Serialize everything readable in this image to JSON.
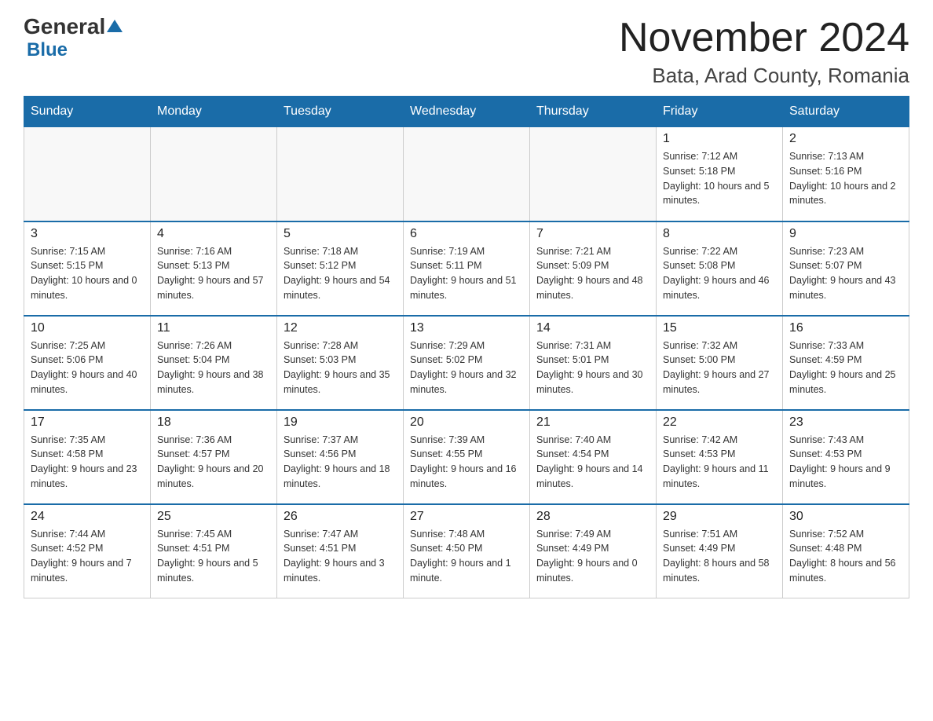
{
  "header": {
    "logo_general": "General",
    "logo_blue": "Blue",
    "month_title": "November 2024",
    "location": "Bata, Arad County, Romania"
  },
  "days_of_week": [
    "Sunday",
    "Monday",
    "Tuesday",
    "Wednesday",
    "Thursday",
    "Friday",
    "Saturday"
  ],
  "weeks": [
    [
      {
        "day": "",
        "info": ""
      },
      {
        "day": "",
        "info": ""
      },
      {
        "day": "",
        "info": ""
      },
      {
        "day": "",
        "info": ""
      },
      {
        "day": "",
        "info": ""
      },
      {
        "day": "1",
        "info": "Sunrise: 7:12 AM\nSunset: 5:18 PM\nDaylight: 10 hours and 5 minutes."
      },
      {
        "day": "2",
        "info": "Sunrise: 7:13 AM\nSunset: 5:16 PM\nDaylight: 10 hours and 2 minutes."
      }
    ],
    [
      {
        "day": "3",
        "info": "Sunrise: 7:15 AM\nSunset: 5:15 PM\nDaylight: 10 hours and 0 minutes."
      },
      {
        "day": "4",
        "info": "Sunrise: 7:16 AM\nSunset: 5:13 PM\nDaylight: 9 hours and 57 minutes."
      },
      {
        "day": "5",
        "info": "Sunrise: 7:18 AM\nSunset: 5:12 PM\nDaylight: 9 hours and 54 minutes."
      },
      {
        "day": "6",
        "info": "Sunrise: 7:19 AM\nSunset: 5:11 PM\nDaylight: 9 hours and 51 minutes."
      },
      {
        "day": "7",
        "info": "Sunrise: 7:21 AM\nSunset: 5:09 PM\nDaylight: 9 hours and 48 minutes."
      },
      {
        "day": "8",
        "info": "Sunrise: 7:22 AM\nSunset: 5:08 PM\nDaylight: 9 hours and 46 minutes."
      },
      {
        "day": "9",
        "info": "Sunrise: 7:23 AM\nSunset: 5:07 PM\nDaylight: 9 hours and 43 minutes."
      }
    ],
    [
      {
        "day": "10",
        "info": "Sunrise: 7:25 AM\nSunset: 5:06 PM\nDaylight: 9 hours and 40 minutes."
      },
      {
        "day": "11",
        "info": "Sunrise: 7:26 AM\nSunset: 5:04 PM\nDaylight: 9 hours and 38 minutes."
      },
      {
        "day": "12",
        "info": "Sunrise: 7:28 AM\nSunset: 5:03 PM\nDaylight: 9 hours and 35 minutes."
      },
      {
        "day": "13",
        "info": "Sunrise: 7:29 AM\nSunset: 5:02 PM\nDaylight: 9 hours and 32 minutes."
      },
      {
        "day": "14",
        "info": "Sunrise: 7:31 AM\nSunset: 5:01 PM\nDaylight: 9 hours and 30 minutes."
      },
      {
        "day": "15",
        "info": "Sunrise: 7:32 AM\nSunset: 5:00 PM\nDaylight: 9 hours and 27 minutes."
      },
      {
        "day": "16",
        "info": "Sunrise: 7:33 AM\nSunset: 4:59 PM\nDaylight: 9 hours and 25 minutes."
      }
    ],
    [
      {
        "day": "17",
        "info": "Sunrise: 7:35 AM\nSunset: 4:58 PM\nDaylight: 9 hours and 23 minutes."
      },
      {
        "day": "18",
        "info": "Sunrise: 7:36 AM\nSunset: 4:57 PM\nDaylight: 9 hours and 20 minutes."
      },
      {
        "day": "19",
        "info": "Sunrise: 7:37 AM\nSunset: 4:56 PM\nDaylight: 9 hours and 18 minutes."
      },
      {
        "day": "20",
        "info": "Sunrise: 7:39 AM\nSunset: 4:55 PM\nDaylight: 9 hours and 16 minutes."
      },
      {
        "day": "21",
        "info": "Sunrise: 7:40 AM\nSunset: 4:54 PM\nDaylight: 9 hours and 14 minutes."
      },
      {
        "day": "22",
        "info": "Sunrise: 7:42 AM\nSunset: 4:53 PM\nDaylight: 9 hours and 11 minutes."
      },
      {
        "day": "23",
        "info": "Sunrise: 7:43 AM\nSunset: 4:53 PM\nDaylight: 9 hours and 9 minutes."
      }
    ],
    [
      {
        "day": "24",
        "info": "Sunrise: 7:44 AM\nSunset: 4:52 PM\nDaylight: 9 hours and 7 minutes."
      },
      {
        "day": "25",
        "info": "Sunrise: 7:45 AM\nSunset: 4:51 PM\nDaylight: 9 hours and 5 minutes."
      },
      {
        "day": "26",
        "info": "Sunrise: 7:47 AM\nSunset: 4:51 PM\nDaylight: 9 hours and 3 minutes."
      },
      {
        "day": "27",
        "info": "Sunrise: 7:48 AM\nSunset: 4:50 PM\nDaylight: 9 hours and 1 minute."
      },
      {
        "day": "28",
        "info": "Sunrise: 7:49 AM\nSunset: 4:49 PM\nDaylight: 9 hours and 0 minutes."
      },
      {
        "day": "29",
        "info": "Sunrise: 7:51 AM\nSunset: 4:49 PM\nDaylight: 8 hours and 58 minutes."
      },
      {
        "day": "30",
        "info": "Sunrise: 7:52 AM\nSunset: 4:48 PM\nDaylight: 8 hours and 56 minutes."
      }
    ]
  ]
}
